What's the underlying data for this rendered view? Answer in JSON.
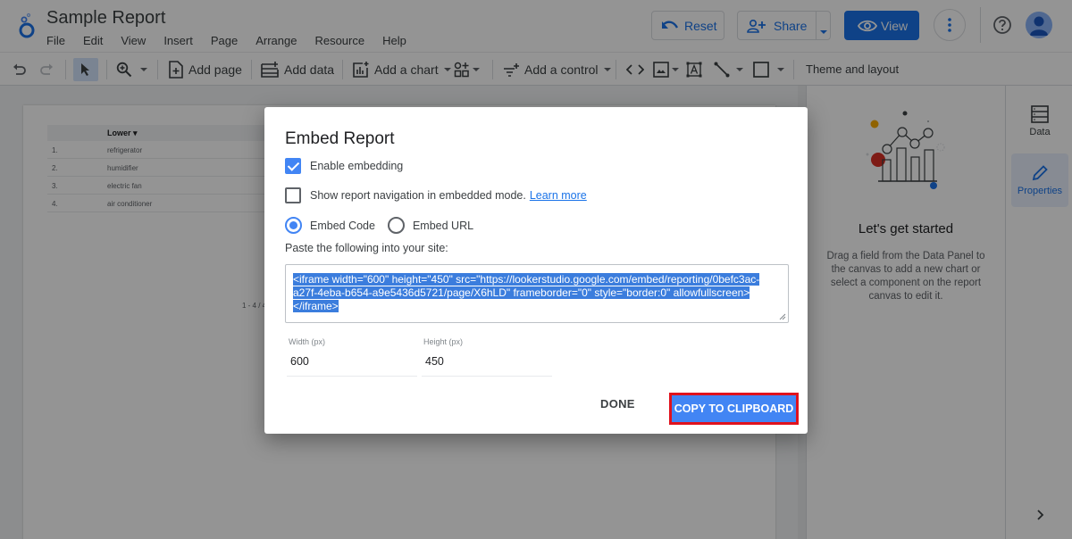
{
  "header": {
    "title": "Sample Report",
    "menu": [
      "File",
      "Edit",
      "View",
      "Insert",
      "Page",
      "Arrange",
      "Resource",
      "Help"
    ],
    "reset_label": "Reset",
    "share_label": "Share",
    "view_label": "View"
  },
  "toolbar": {
    "add_page": "Add page",
    "add_data": "Add data",
    "add_chart": "Add a chart",
    "add_control": "Add a control",
    "theme_layout": "Theme and layout"
  },
  "report_table": {
    "column_header": "Lower",
    "rows": [
      {
        "index": "1.",
        "value": "refrigerator"
      },
      {
        "index": "2.",
        "value": "humidifier"
      },
      {
        "index": "3.",
        "value": "electric fan"
      },
      {
        "index": "4.",
        "value": "air conditioner"
      }
    ],
    "pager": "1 - 4 / 4"
  },
  "right_panel": {
    "title": "Let's get started",
    "description": "Drag a field from the Data Panel to the canvas to add a new chart or select a component on the report canvas to edit it.",
    "rail": [
      {
        "label": "Data",
        "icon": "data-icon",
        "active": false
      },
      {
        "label": "Properties",
        "icon": "pencil-icon",
        "active": true
      }
    ]
  },
  "dialog": {
    "title": "Embed Report",
    "enable_embedding": {
      "label": "Enable embedding",
      "checked": true
    },
    "show_navigation": {
      "label": "Show report navigation in embedded mode.",
      "checked": false,
      "link": "Learn more"
    },
    "embed_options": [
      {
        "label": "Embed Code",
        "selected": true
      },
      {
        "label": "Embed URL",
        "selected": false
      }
    ],
    "paste_label": "Paste the following into your site:",
    "code": "<iframe width=\"600\" height=\"450\" src=\"https://lookerstudio.google.com/embed/reporting/0befc3ac-a27f-4eba-b654-a9e5436d5721/page/X6hLD\" frameborder=\"0\" style=\"border:0\" allowfullscreen></iframe>",
    "width_label": "Width (px)",
    "width_value": "600",
    "height_label": "Height (px)",
    "height_value": "450",
    "done_label": "DONE",
    "copy_label": "COPY TO CLIPBOARD"
  },
  "colors": {
    "accent": "#1a73e8",
    "primary_button": "#4285f4",
    "highlight_border": "#e0121d"
  }
}
